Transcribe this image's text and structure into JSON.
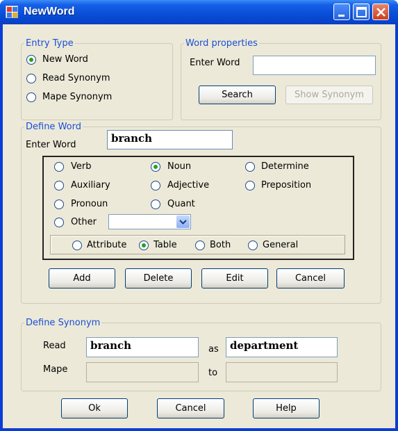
{
  "window": {
    "title": "NewWord",
    "icon": "app-grid-icon",
    "controls": [
      "minimize-icon",
      "maximize-icon",
      "close-icon"
    ]
  },
  "entry_type": {
    "legend": "Entry Type",
    "options": [
      {
        "label": "New Word",
        "checked": true
      },
      {
        "label": "Read Synonym",
        "checked": false
      },
      {
        "label": "Mape Synonym",
        "checked": false
      }
    ]
  },
  "word_properties": {
    "legend": "Word properties",
    "enter_word_label": "Enter Word",
    "enter_word_value": "",
    "search_label": "Search",
    "show_synonym_label": "Show Synonym"
  },
  "define_word": {
    "legend": "Define Word",
    "enter_word_label": "Enter Word",
    "enter_word_value": "branch",
    "pos_options": [
      {
        "label": "Verb",
        "checked": false
      },
      {
        "label": "Noun",
        "checked": true
      },
      {
        "label": "Determine",
        "checked": false
      },
      {
        "label": "Auxiliary",
        "checked": false
      },
      {
        "label": "Adjective",
        "checked": false
      },
      {
        "label": "Preposition",
        "checked": false
      },
      {
        "label": "Pronoun",
        "checked": false
      },
      {
        "label": "Quant",
        "checked": false
      },
      {
        "label": "Other",
        "checked": false
      }
    ],
    "other_select_value": "",
    "kind_options": [
      {
        "label": "Attribute",
        "checked": false
      },
      {
        "label": "Table",
        "checked": true
      },
      {
        "label": "Both",
        "checked": false
      },
      {
        "label": "General",
        "checked": false
      }
    ],
    "buttons": {
      "add": "Add",
      "delete": "Delete",
      "edit": "Edit",
      "cancel": "Cancel"
    }
  },
  "define_synonym": {
    "legend": "Define Synonym",
    "read_label": "Read",
    "read_value": "branch",
    "as_label": "as",
    "as_value": "department",
    "mape_label": "Mape",
    "mape_value": "",
    "to_label": "to",
    "to_value": ""
  },
  "footer": {
    "ok": "Ok",
    "cancel": "Cancel",
    "help": "Help"
  },
  "colors": {
    "title_bar": "#0a4fd8",
    "dialog_bg": "#ece9d8",
    "group_legend": "#1a4fd6",
    "radio_check": "#21a121"
  }
}
